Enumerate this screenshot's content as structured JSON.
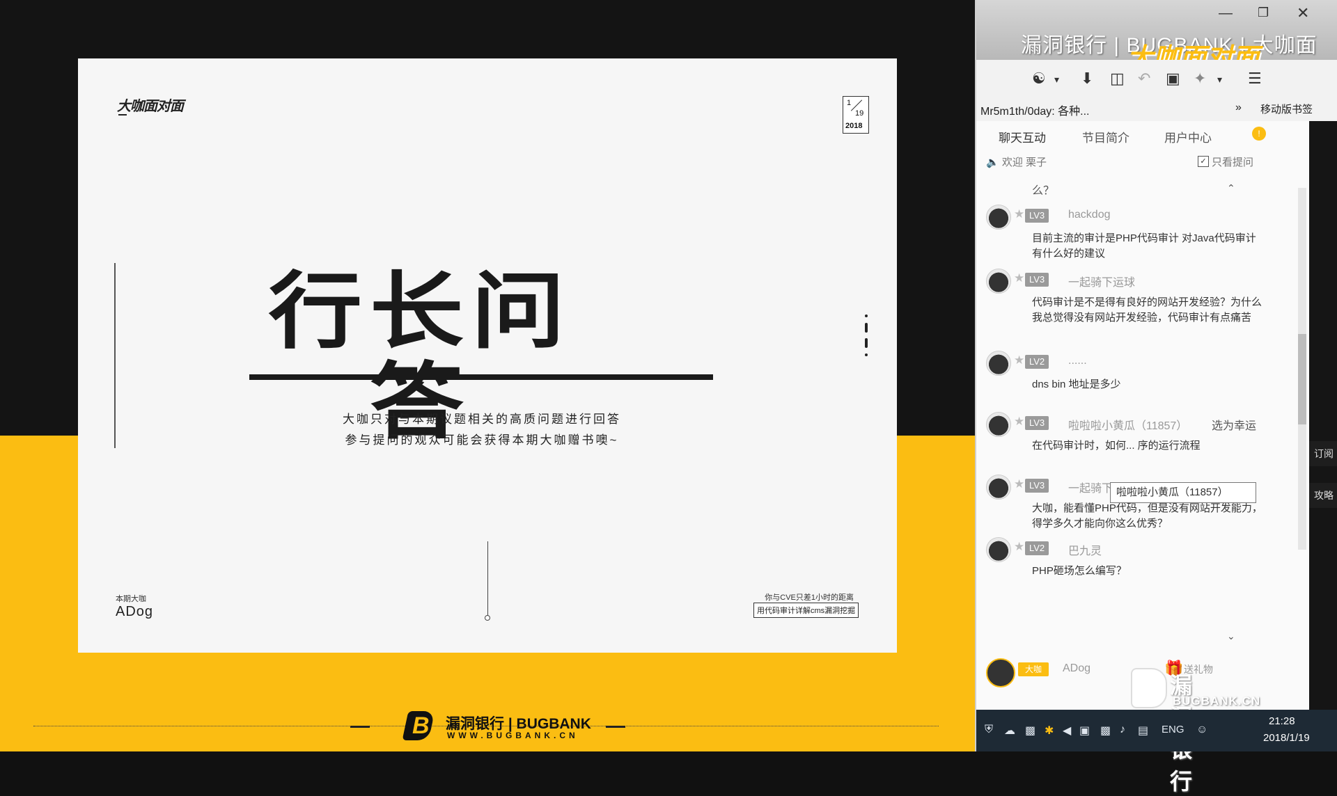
{
  "slide": {
    "brand": "大咖面对面",
    "date_month": "1",
    "date_day": "19",
    "date_year": "2018",
    "title": "行长问答",
    "subtitle_line1": "大咖只对与本期议题相关的高质问题进行回答",
    "subtitle_line2": "参与提问的观众可能会获得本期大咖赠书噢~",
    "guest_label": "本期大咖",
    "guest_name": "ADog",
    "cve_note": "你与CVE只差1小时的距离",
    "cve_topic": "用代码审计详解cms漏洞挖掘"
  },
  "footer": {
    "brand": "漏洞银行 | BUGBANK",
    "url": "WWW.BUGBANK.CN"
  },
  "window": {
    "title": "漏洞银行 | BUGBANK | 大咖面对面",
    "overlay_brand": "大咖面对面",
    "min_icon": "minimize-icon",
    "restore_icon": "restore-icon",
    "close_icon": "close-icon"
  },
  "toolbar": {
    "icons": [
      "palette-icon",
      "download-icon",
      "sidebar-icon",
      "undo-icon",
      "screenshot-icon",
      "pin-icon",
      "menu-icon"
    ]
  },
  "bookmarks": {
    "left": "Mr5m1th/0day: 各种...",
    "more": "»",
    "right": "移动版书签"
  },
  "tabs": [
    {
      "label": "聊天互动"
    },
    {
      "label": "节目简介"
    },
    {
      "label": "用户中心"
    }
  ],
  "tab_badge": "!",
  "chat": {
    "welcome": "欢迎  栗子",
    "only_questions": "只看提问",
    "top_text": "么？",
    "messages": [
      {
        "level": "LV3",
        "user": "hackdog",
        "text": "目前主流的审计是PHP代码审计 对Java代码审计 有什么好的建议"
      },
      {
        "level": "LV3",
        "user": "一起骑下运球",
        "text": "代码审计是不是得有良好的网站开发经验？为什么我总觉得没有网站开发经验，代码审计有点痛苦"
      },
      {
        "level": "LV2",
        "user": "......",
        "text": "dns bin 地址是多少"
      },
      {
        "level": "LV3",
        "user": "啦啦啦小黄瓜（11857）",
        "extra": "选为幸运",
        "text": "在代码审计时，如何... 序的运行流程"
      },
      {
        "level": "LV3",
        "user": "一起骑下运球",
        "text": "大咖，能看懂PHP代码，但是没有网站开发能力，得学多久才能向你这么优秀？"
      },
      {
        "level": "LV2",
        "user": "巴九灵",
        "text": "PHP砸场怎么编写？"
      }
    ],
    "tooltip": "啦啦啦小黄瓜（11857）",
    "me_badge": "大咖",
    "me_name": "ADog",
    "gift_label": "送礼物"
  },
  "side_buttons": {
    "subscribe": "订阅",
    "guide": "攻略"
  },
  "watermark": {
    "text": "漏洞银行",
    "url": "BUGBANK.CN"
  },
  "taskbar": {
    "ime": "ENG",
    "time": "21:28",
    "date": "2018/1/19"
  },
  "colors": {
    "accent_yellow": "#fbbd12",
    "dark_bg": "#141414",
    "slide_bg": "#f6f6f6"
  }
}
